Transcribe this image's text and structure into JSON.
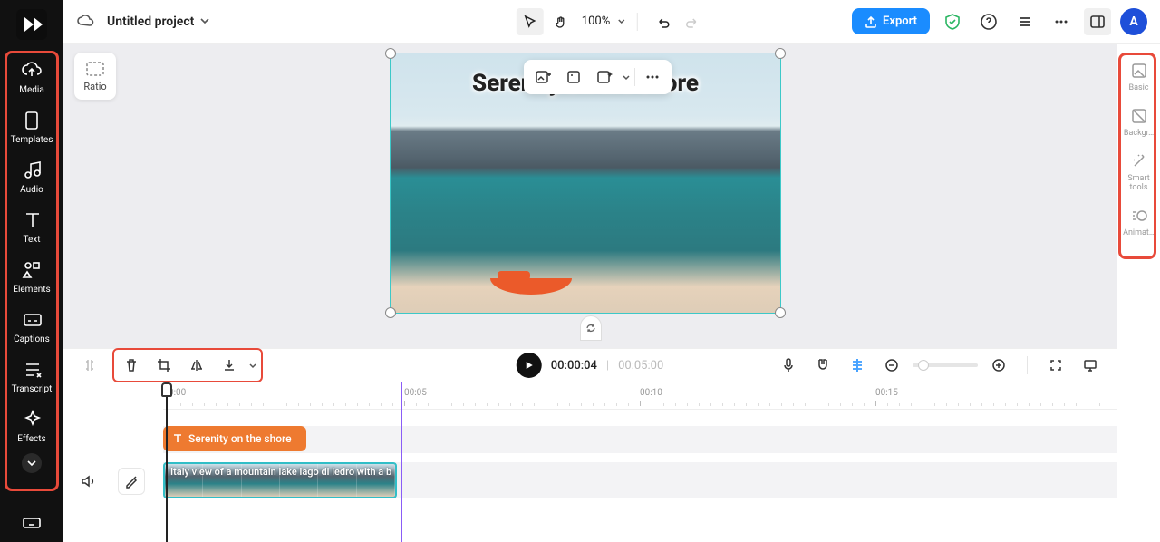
{
  "header": {
    "project_title": "Untitled project",
    "zoom": "100%",
    "export_label": "Export",
    "avatar_initial": "A"
  },
  "sidebar": {
    "items": [
      {
        "label": "Media"
      },
      {
        "label": "Templates"
      },
      {
        "label": "Audio"
      },
      {
        "label": "Text"
      },
      {
        "label": "Elements"
      },
      {
        "label": "Captions"
      },
      {
        "label": "Transcript"
      },
      {
        "label": "Effects"
      }
    ]
  },
  "ratio": {
    "label": "Ratio"
  },
  "canvas": {
    "title_text": "Serenity on the shore"
  },
  "right_panel": {
    "items": [
      {
        "label": "Basic"
      },
      {
        "label": "Backgr…"
      },
      {
        "label": "Smart tools"
      },
      {
        "label": "Animat…"
      }
    ]
  },
  "timeline": {
    "current": "00:00:04",
    "total": "00:05:00",
    "ruler": [
      "0:00",
      "00:05",
      "00:10",
      "00:15"
    ],
    "text_clip_label": "Serenity on the shore",
    "video_clip_label": "Italy view of a mountain lake lago di ledro with a b"
  }
}
